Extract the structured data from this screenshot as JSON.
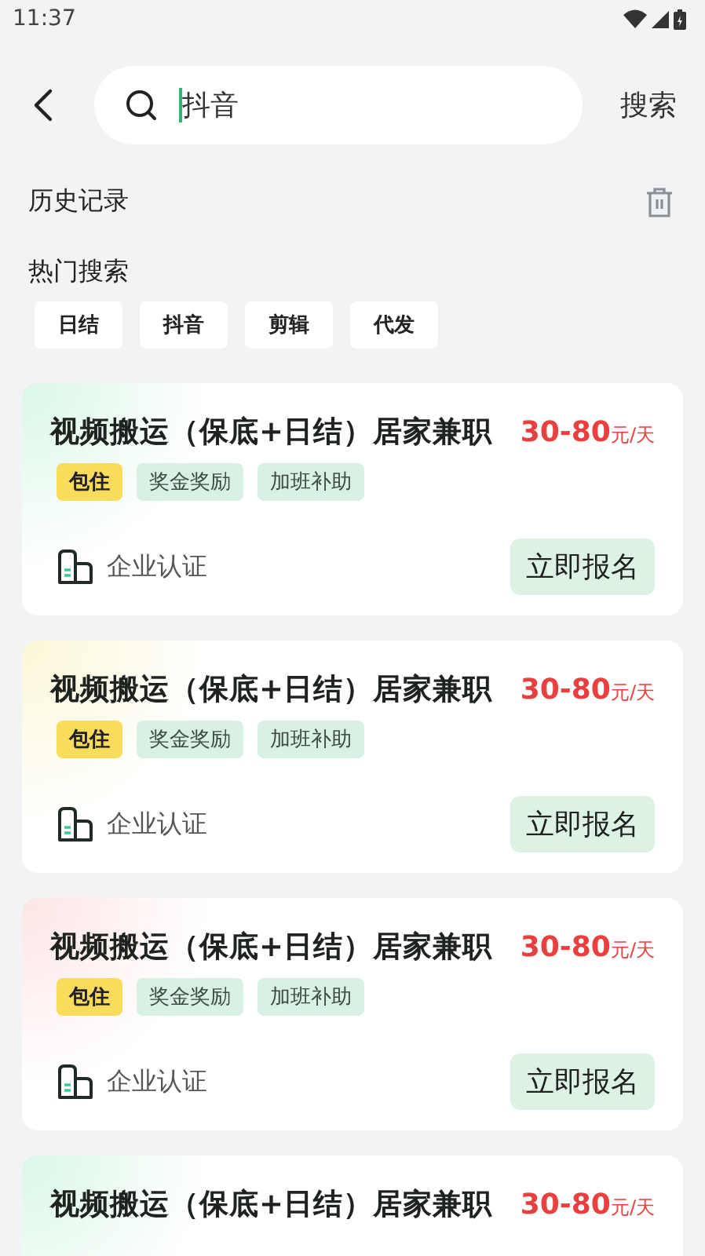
{
  "status_bar": {
    "time": "11:37"
  },
  "search": {
    "value": "抖音",
    "button": "搜索"
  },
  "history": {
    "title": "历史记录"
  },
  "hot": {
    "title": "热门搜索",
    "chips": [
      "日结",
      "抖音",
      "剪辑",
      "代发"
    ]
  },
  "jobs": [
    {
      "title": "视频搬运（保底+日结）居家兼职",
      "price": "30-80",
      "unit": "元/天",
      "color": "#d9f7e6",
      "tags": [
        {
          "label": "包住",
          "kind": "highlight"
        },
        {
          "label": "奖金奖励",
          "kind": "normal"
        },
        {
          "label": "加班补助",
          "kind": "normal"
        }
      ],
      "company": "企业认证",
      "action": "立即报名"
    },
    {
      "title": "视频搬运（保底+日结）居家兼职",
      "price": "30-80",
      "unit": "元/天",
      "color": "#fbf7d6",
      "tags": [
        {
          "label": "包住",
          "kind": "highlight"
        },
        {
          "label": "奖金奖励",
          "kind": "normal"
        },
        {
          "label": "加班补助",
          "kind": "normal"
        }
      ],
      "company": "企业认证",
      "action": "立即报名"
    },
    {
      "title": "视频搬运（保底+日结）居家兼职",
      "price": "30-80",
      "unit": "元/天",
      "color": "#fde4e4",
      "tags": [
        {
          "label": "包住",
          "kind": "highlight"
        },
        {
          "label": "奖金奖励",
          "kind": "normal"
        },
        {
          "label": "加班补助",
          "kind": "normal"
        }
      ],
      "company": "企业认证",
      "action": "立即报名"
    },
    {
      "title": "视频搬运（保底+日结）居家兼职",
      "price": "30-80",
      "unit": "元/天",
      "color": "#d9f7e6"
    }
  ]
}
